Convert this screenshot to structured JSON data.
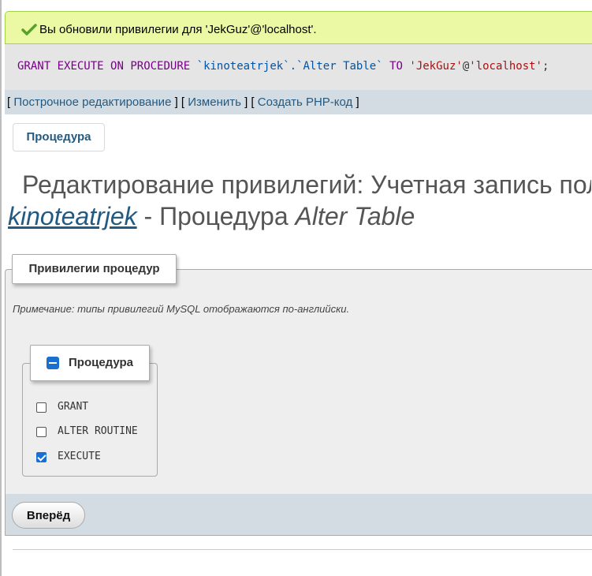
{
  "message": {
    "icon": "check-icon",
    "text": "Вы обновили привилегии для 'JekGuz'@'localhost'.",
    "accent_color": "#5aa12a"
  },
  "sql": {
    "kw_grant": "GRANT",
    "kw_execute": "EXECUTE",
    "kw_on": "ON",
    "kw_procedure": "PROCEDURE",
    "target": "`kinoteatrjek`.`Alter Table`",
    "kw_to": "TO",
    "user": "'JekGuz'",
    "host_sep": "@",
    "host": "'localhost'",
    "terminator": ";"
  },
  "links": {
    "inline_edit": "Построчное редактирование",
    "edit": "Изменить",
    "create_php": "Создать PHP-код"
  },
  "tabs": [
    {
      "label": "Процедура"
    }
  ],
  "heading": {
    "line1": "Редактирование привилегий: Учетная запись пол",
    "database": "kinoteatrjek",
    "separator": " - Процедура ",
    "procedure": "Alter Table"
  },
  "fieldset": {
    "legend": "Привилегии процедур",
    "note": "Примечание: типы привилегий MySQL отображаются по-английски."
  },
  "procedure_group": {
    "legend": "Процедура",
    "privileges": [
      {
        "label": "GRANT",
        "checked": false
      },
      {
        "label": "ALTER ROUTINE",
        "checked": false
      },
      {
        "label": "EXECUTE",
        "checked": true
      }
    ]
  },
  "footer": {
    "go_label": "Вперёд"
  }
}
